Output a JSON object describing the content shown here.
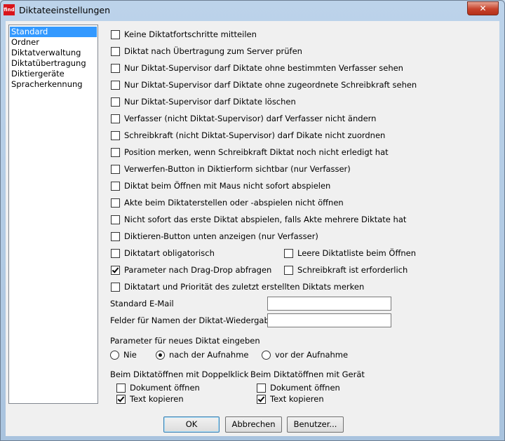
{
  "window": {
    "title": "Diktateeinstellungen",
    "app_icon_text": "find",
    "close_glyph": "✕"
  },
  "sidebar": {
    "items": [
      {
        "label": "Standard",
        "selected": true
      },
      {
        "label": "Ordner",
        "selected": false
      },
      {
        "label": "Diktatverwaltung",
        "selected": false
      },
      {
        "label": "Diktatübertragung",
        "selected": false
      },
      {
        "label": "Diktiergeräte",
        "selected": false
      },
      {
        "label": "Spracherkennung",
        "selected": false
      }
    ]
  },
  "options": {
    "opt1": {
      "label": "Keine Diktatfortschritte mitteilen",
      "checked": false
    },
    "opt2": {
      "label": "Diktat nach Übertragung zum Server prüfen",
      "checked": false
    },
    "opt3": {
      "label": "Nur Diktat-Supervisor darf Diktate ohne bestimmten Verfasser sehen",
      "checked": false
    },
    "opt4": {
      "label": "Nur Diktat-Supervisor darf Diktate ohne zugeordnete Schreibkraft sehen",
      "checked": false
    },
    "opt5": {
      "label": "Nur Diktat-Supervisor darf Diktate löschen",
      "checked": false
    },
    "opt6": {
      "label": "Verfasser (nicht Diktat-Supervisor) darf Verfasser nicht ändern",
      "checked": false
    },
    "opt7": {
      "label": "Schreibkraft (nicht Diktat-Supervisor) darf Dikate nicht zuordnen",
      "checked": false
    },
    "opt8": {
      "label": "Position merken, wenn Schreibkraft Diktat noch nicht erledigt hat",
      "checked": false
    },
    "opt9": {
      "label": "Verwerfen-Button in Diktierform sichtbar (nur Verfasser)",
      "checked": false
    },
    "opt10": {
      "label": "Diktat beim Öffnen mit Maus nicht sofort abspielen",
      "checked": false
    },
    "opt11": {
      "label": "Akte beim Diktaterstellen oder -abspielen nicht öffnen",
      "checked": false
    },
    "opt12": {
      "label": "Nicht sofort das erste Diktat abspielen, falls Akte mehrere Diktate hat",
      "checked": false
    },
    "opt13": {
      "label": "Diktieren-Button unten anzeigen (nur Verfasser)",
      "checked": false
    },
    "opt14": {
      "label": "Diktatart obligatorisch",
      "checked": false
    },
    "opt15": {
      "label": "Leere Diktatliste beim Öffnen",
      "checked": false
    },
    "opt16": {
      "label": "Parameter nach Drag-Drop abfragen",
      "checked": true
    },
    "opt17": {
      "label": "Schreibkraft ist erforderlich",
      "checked": false
    },
    "opt18": {
      "label": "Diktatart und Priorität des zuletzt erstellten Diktats merken",
      "checked": false
    }
  },
  "fields": {
    "email_label": "Standard E-Mail",
    "email_value": "",
    "names_label": "Felder für Namen der Diktat-Wiedergabe",
    "names_value": ""
  },
  "params": {
    "label": "Parameter für neues Diktat eingeben",
    "options": [
      {
        "label": "Nie",
        "checked": false
      },
      {
        "label": "nach der Aufnahme",
        "checked": true
      },
      {
        "label": "vor der Aufnahme",
        "checked": false
      }
    ]
  },
  "doubleclick": {
    "label": "Beim Diktatöffnen mit Doppelklick",
    "open_doc": {
      "label": "Dokument öffnen",
      "checked": false
    },
    "copy_text": {
      "label": "Text kopieren",
      "checked": true
    }
  },
  "device": {
    "label": "Beim Diktatöffnen mit Gerät",
    "open_doc": {
      "label": "Dokument öffnen",
      "checked": false
    },
    "copy_text": {
      "label": "Text kopieren",
      "checked": true
    }
  },
  "buttons": {
    "ok": "OK",
    "cancel": "Abbrechen",
    "user": "Benutzer..."
  }
}
